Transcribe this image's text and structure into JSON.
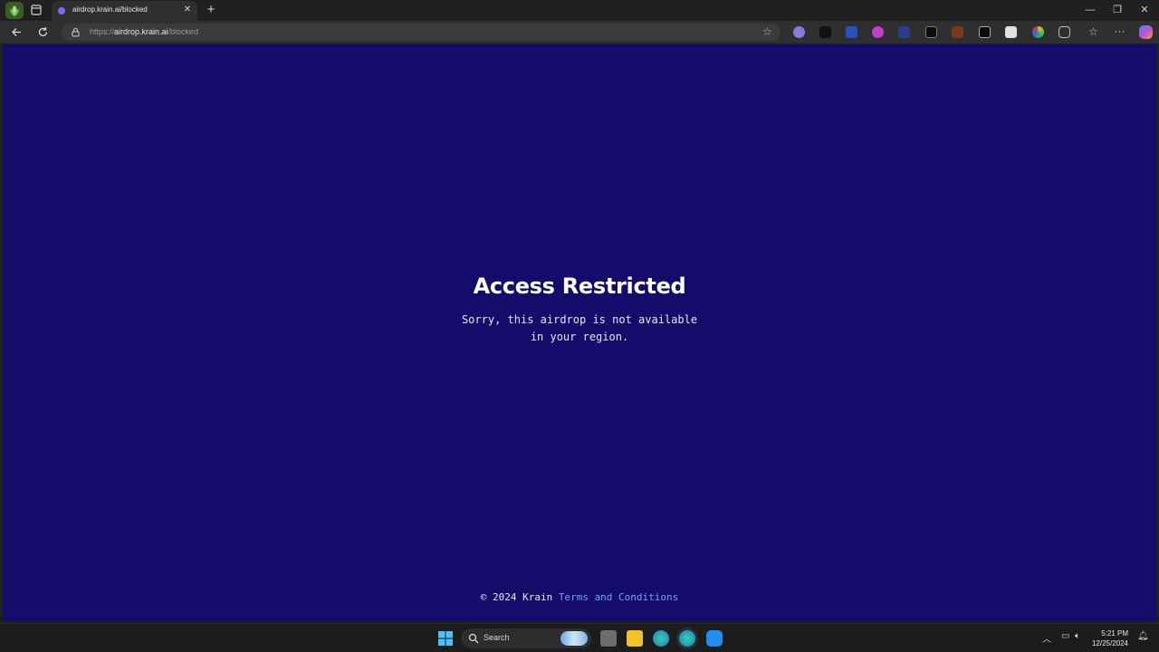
{
  "browser": {
    "tab": {
      "title": "airdrop.krain.ai/blocked"
    },
    "address": {
      "scheme": "https://",
      "host": "airdrop.krain.ai",
      "path": "/blocked"
    }
  },
  "page": {
    "title": "Access Restricted",
    "message_line1": "Sorry, this airdrop is not available",
    "message_line2": "in your region.",
    "footer_copyright": "© 2024 Krain",
    "footer_link": "Terms and Conditions",
    "background": "#150b6b",
    "link_color": "#6ea0ff"
  },
  "taskbar": {
    "search_label": "Search",
    "time": "5:21 PM",
    "date": "12/25/2024"
  }
}
